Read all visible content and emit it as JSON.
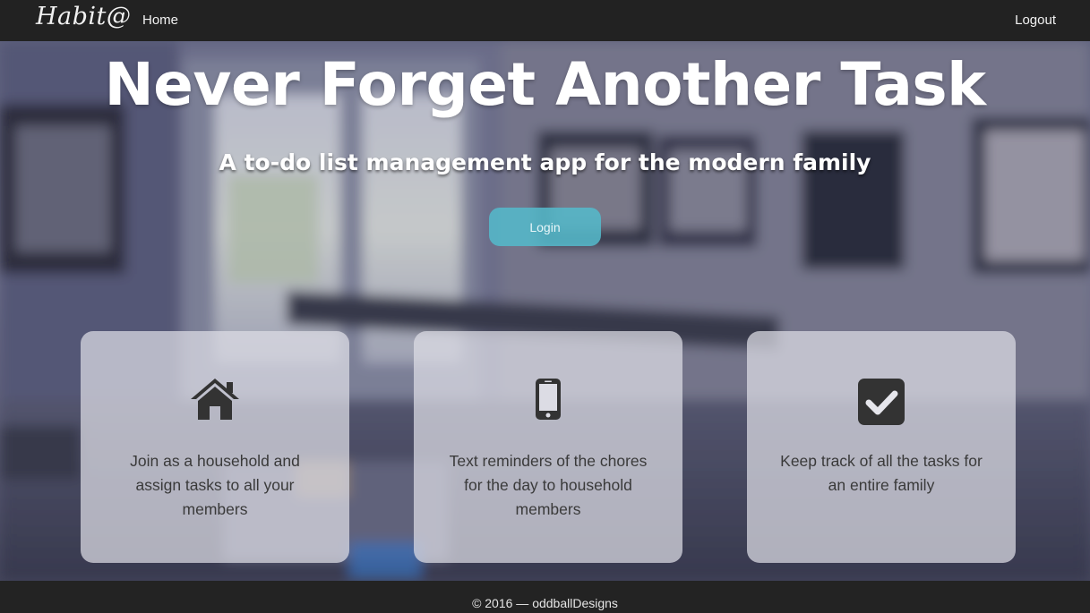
{
  "navbar": {
    "brand": "Habit@",
    "home_label": "Home",
    "logout_label": "Logout"
  },
  "hero": {
    "title": "Never Forget Another Task",
    "subtitle": "A to-do list management app for the modern family",
    "login_label": "Login"
  },
  "features": [
    {
      "icon": "house-icon",
      "text": "Join as a household and assign tasks to all your members"
    },
    {
      "icon": "smartphone-icon",
      "text": "Text reminders of the chores for the day to household members"
    },
    {
      "icon": "checkbox-checked-icon",
      "text": "Keep track of all the tasks for an entire family"
    }
  ],
  "footer": {
    "text": "© 2016 — oddballDesigns"
  },
  "colors": {
    "navbar_bg": "#222222",
    "login_button": "#54b8c9",
    "card_bg": "#dedee6",
    "icon_color": "#333333"
  }
}
